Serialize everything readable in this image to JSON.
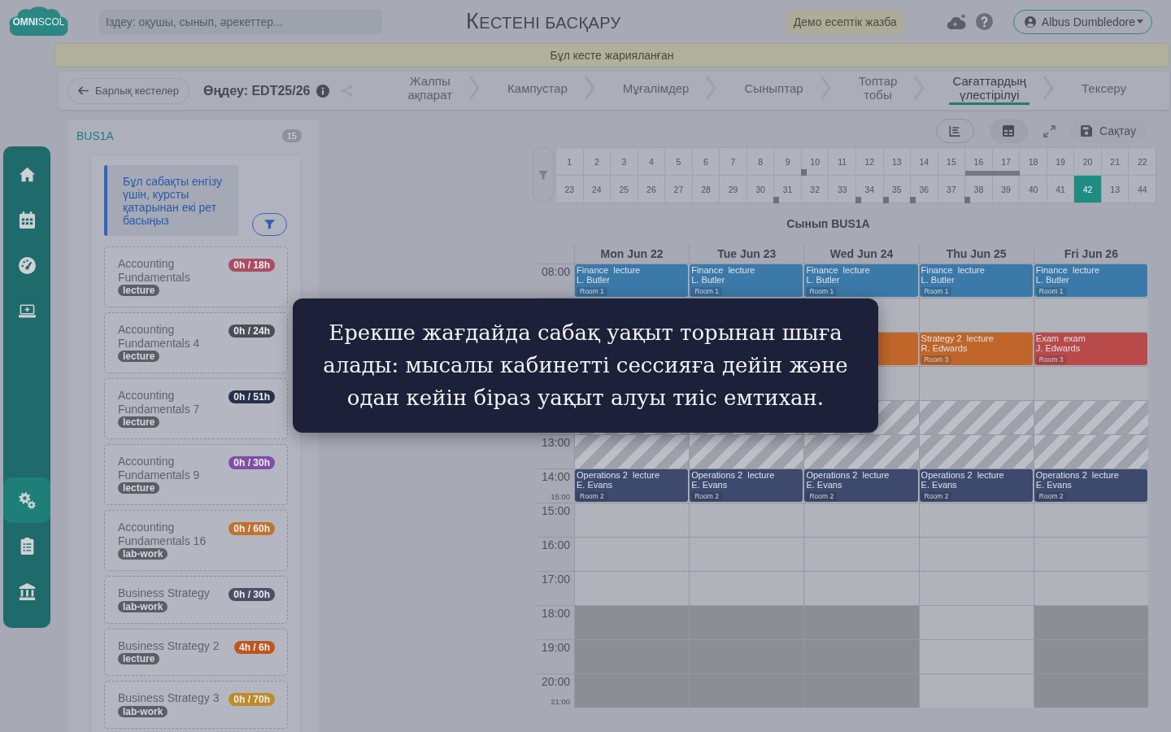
{
  "header": {
    "logo": "**OMNI**SCOL",
    "search": {
      "placeholder": "Іздеу: оқушы, сынып, әрекеттер..."
    },
    "title": "КЕСТЕНІ БАСҚАРУ",
    "demo_badge": "Демо есептік жазба",
    "user": {
      "name": "Albus Dumbledore"
    }
  },
  "banner": "Бұл кесте жарияланған",
  "sidebar": {
    "top_items": [
      {
        "kind": "home",
        "selected": false
      },
      {
        "kind": "calendar",
        "selected": false
      },
      {
        "kind": "gauge",
        "selected": false
      },
      {
        "kind": "laptop",
        "selected": false
      }
    ],
    "bottom_items": [
      {
        "kind": "gears",
        "selected": true
      },
      {
        "kind": "clipboard",
        "selected": false
      },
      {
        "kind": "bank",
        "selected": false
      }
    ]
  },
  "toolbar": {
    "back": "Барлық кестелер",
    "edit_title": "Өңдеу: EDT25/26",
    "steps": [
      {
        "label": "Жалпы ақпарат",
        "selected": false
      },
      {
        "label": "Кампустар",
        "selected": false
      },
      {
        "label": "Мұғалімдер",
        "selected": false
      },
      {
        "label": "Сыныптар",
        "selected": false
      },
      {
        "label": "Топтар тобы",
        "selected": false
      },
      {
        "label": "Сағаттардың үлестірілуі",
        "selected": true
      },
      {
        "label": "Тексеру",
        "selected": false
      }
    ]
  },
  "left_panel": {
    "title": "BUS1A",
    "count": "15",
    "hint": "Бұл сабақты енгізу үшін, курсты қатарынан екі рет басыңыз",
    "courses": [
      {
        "name": "Accounting Fundamentals",
        "hours": "0h / 18h",
        "color": "#a94d62",
        "type": "lecture"
      },
      {
        "name": "Accounting Fundamentals 4",
        "hours": "0h / 24h",
        "color": "#4b4e57",
        "type": "lecture"
      },
      {
        "name": "Accounting Fundamentals 7",
        "hours": "0h / 51h",
        "color": "#253148",
        "type": "lecture"
      },
      {
        "name": "Accounting Fundamentals 9",
        "hours": "0h / 30h",
        "color": "#7f4fa6",
        "type": "lecture"
      },
      {
        "name": "Accounting Fundamentals 16",
        "hours": "0h / 60h",
        "color": "#c0722f",
        "type": "lab-work"
      },
      {
        "name": "Business Strategy",
        "hours": "0h / 30h",
        "color": "#4a4f66",
        "type": "lab-work"
      },
      {
        "name": "Business Strategy 2",
        "hours": "4h / 6h",
        "color": "#be561e",
        "type": "lecture"
      },
      {
        "name": "Business Strategy 3",
        "hours": "0h / 70h",
        "color": "#bf8a2b",
        "type": "lab-work"
      }
    ]
  },
  "calendar": {
    "toolbar": {
      "views": [
        {
          "kind": "list",
          "selected": false
        },
        {
          "kind": "grid",
          "selected": true
        }
      ],
      "save": {
        "label": "Сақтау",
        "disabled": true
      }
    },
    "weeks": [
      {
        "label": "1",
        "selected": false
      },
      {
        "label": "2",
        "selected": false
      },
      {
        "label": "3",
        "selected": false
      },
      {
        "label": "4",
        "selected": false
      },
      {
        "label": "5",
        "selected": false
      },
      {
        "label": "6",
        "selected": false
      },
      {
        "label": "7",
        "selected": false
      },
      {
        "label": "8",
        "selected": false
      },
      {
        "label": "9",
        "selected": false
      },
      {
        "label": "10",
        "selected": false,
        "marker": {
          "kind": "dot"
        }
      },
      {
        "label": "11",
        "selected": false
      },
      {
        "label": "12",
        "selected": false
      },
      {
        "label": "13",
        "selected": false
      },
      {
        "label": "14",
        "selected": false
      },
      {
        "label": "15",
        "selected": false
      },
      {
        "label": "16",
        "selected": false,
        "marker": {
          "kind": "bar"
        }
      },
      {
        "label": "17",
        "selected": false,
        "marker": {
          "kind": "bar"
        }
      },
      {
        "label": "18",
        "selected": false
      },
      {
        "label": "19",
        "selected": false
      },
      {
        "label": "20",
        "selected": false
      },
      {
        "label": "21",
        "selected": false
      },
      {
        "label": "22",
        "selected": false
      },
      {
        "label": "23",
        "selected": false
      },
      {
        "label": "24",
        "selected": false
      },
      {
        "label": "25",
        "selected": false
      },
      {
        "label": "26",
        "selected": false
      },
      {
        "label": "27",
        "selected": false
      },
      {
        "label": "28",
        "selected": false
      },
      {
        "label": "29",
        "selected": false
      },
      {
        "label": "30",
        "selected": false
      },
      {
        "label": "31",
        "selected": false,
        "marker": {
          "kind": "dot"
        }
      },
      {
        "label": "32",
        "selected": false
      },
      {
        "label": "33",
        "selected": false
      },
      {
        "label": "34",
        "selected": false,
        "marker": {
          "kind": "dot"
        }
      },
      {
        "label": "35",
        "selected": false,
        "marker": {
          "kind": "dot"
        }
      },
      {
        "label": "36",
        "selected": false,
        "marker": {
          "kind": "dot"
        }
      },
      {
        "label": "37",
        "selected": false
      },
      {
        "label": "38",
        "selected": false,
        "marker": {
          "kind": "dot"
        }
      },
      {
        "label": "39",
        "selected": false
      },
      {
        "label": "40",
        "selected": false
      },
      {
        "label": "41",
        "selected": false
      },
      {
        "label": "42",
        "selected": true
      },
      {
        "label": "13",
        "selected": false
      },
      {
        "label": "44",
        "selected": false
      }
    ],
    "title": "Сынып BUS1A",
    "days": [
      {
        "label": "Mon Jun 22"
      },
      {
        "label": "Tue Jun 23"
      },
      {
        "label": "Wed Jun 24"
      },
      {
        "label": "Thu Jun 25"
      },
      {
        "label": "Fri Jun 26"
      }
    ],
    "rows": [
      {
        "kind": "hour",
        "label": "08:00",
        "cells": [
          {
            "kind": "event",
            "title": "Finance",
            "type": "lecture",
            "teacher": "L. Butler",
            "room": "Room 1",
            "color": "#3b79a9"
          },
          {
            "kind": "event",
            "title": "Finance",
            "type": "lecture",
            "teacher": "L. Butler",
            "room": "Room 1",
            "color": "#3b79a9"
          },
          {
            "kind": "event",
            "title": "Finance",
            "type": "lecture",
            "teacher": "L. Butler",
            "room": "Room 1",
            "color": "#3b79a9"
          },
          {
            "kind": "event",
            "title": "Finance",
            "type": "lecture",
            "teacher": "L. Butler",
            "room": "Room 1",
            "color": "#3b79a9"
          },
          {
            "kind": "event",
            "title": "Finance",
            "type": "lecture",
            "teacher": "L. Butler",
            "room": "Room 1",
            "color": "#3b79a9"
          }
        ]
      },
      {
        "kind": "hour",
        "cells": [
          {
            "kind": "covered"
          },
          {
            "kind": "covered"
          },
          {
            "kind": "free"
          },
          {
            "kind": "free"
          },
          {
            "kind": "free"
          }
        ]
      },
      {
        "kind": "hour",
        "cells": [
          {
            "kind": "covered"
          },
          {
            "kind": "covered"
          },
          {
            "kind": "event",
            "color": "#c0662a"
          },
          {
            "kind": "event",
            "title": "Strategy 2",
            "type": "lecture",
            "teacher": "R. Edwards",
            "room": "Room 3",
            "color": "#c0662a"
          },
          {
            "kind": "event",
            "title": "Exam",
            "type": "exam",
            "teacher": "J. Edwards",
            "room": "Room 3",
            "color": "#b84a4a"
          }
        ]
      },
      {
        "kind": "hour",
        "cells": [
          {
            "kind": "covered"
          },
          {
            "kind": "covered"
          },
          {
            "kind": "free"
          },
          {
            "kind": "free"
          },
          {
            "kind": "free"
          }
        ]
      },
      {
        "kind": "break",
        "cells": [
          {
            "kind": "covered"
          },
          {
            "kind": "covered"
          },
          {
            "kind": "free"
          },
          {
            "kind": "free"
          },
          {
            "kind": "free"
          }
        ]
      },
      {
        "kind": "break",
        "label": "13:00",
        "cells": [
          {
            "kind": "free"
          },
          {
            "kind": "free"
          },
          {
            "kind": "free"
          },
          {
            "kind": "free"
          },
          {
            "kind": "free"
          }
        ]
      },
      {
        "kind": "hour",
        "label": "14:00",
        "end_label": "15:00",
        "cells": [
          {
            "kind": "event",
            "title": "Operations 2",
            "type": "lecture",
            "teacher": "E. Evans",
            "room": "Room 2",
            "color": "#3d4a6e"
          },
          {
            "kind": "event",
            "title": "Operations 2",
            "type": "lecture",
            "teacher": "E. Evans",
            "room": "Room 2",
            "color": "#3d4a6e"
          },
          {
            "kind": "event",
            "title": "Operations 2",
            "type": "lecture",
            "teacher": "E. Evans",
            "room": "Room 2",
            "color": "#3d4a6e"
          },
          {
            "kind": "event",
            "title": "Operations 2",
            "type": "lecture",
            "teacher": "E. Evans",
            "room": "Room 2",
            "color": "#3d4a6e"
          },
          {
            "kind": "event",
            "title": "Operations 2",
            "type": "lecture",
            "teacher": "E. Evans",
            "room": "Room 2",
            "color": "#3d4a6e"
          }
        ]
      },
      {
        "kind": "hour",
        "label": "15:00",
        "cells": [
          {
            "kind": "free"
          },
          {
            "kind": "free"
          },
          {
            "kind": "free"
          },
          {
            "kind": "free"
          },
          {
            "kind": "free"
          }
        ]
      },
      {
        "kind": "hour",
        "label": "16:00",
        "cells": [
          {
            "kind": "free"
          },
          {
            "kind": "free"
          },
          {
            "kind": "free"
          },
          {
            "kind": "free"
          },
          {
            "kind": "free"
          }
        ]
      },
      {
        "kind": "hour",
        "label": "17:00",
        "cells": [
          {
            "kind": "free"
          },
          {
            "kind": "free"
          },
          {
            "kind": "free"
          },
          {
            "kind": "free"
          },
          {
            "kind": "free"
          }
        ]
      },
      {
        "kind": "hour",
        "label": "18:00",
        "cells": [
          {
            "kind": "unavailable"
          },
          {
            "kind": "unavailable"
          },
          {
            "kind": "unavailable"
          },
          {
            "kind": "free"
          },
          {
            "kind": "unavailable"
          }
        ]
      },
      {
        "kind": "hour",
        "label": "19:00",
        "cells": [
          {
            "kind": "unavailable"
          },
          {
            "kind": "unavailable"
          },
          {
            "kind": "unavailable"
          },
          {
            "kind": "free"
          },
          {
            "kind": "unavailable"
          }
        ]
      },
      {
        "kind": "hour",
        "label": "20:00",
        "end_label": "21:00",
        "cells": [
          {
            "kind": "unavailable"
          },
          {
            "kind": "unavailable"
          },
          {
            "kind": "unavailable"
          },
          {
            "kind": "free"
          },
          {
            "kind": "unavailable"
          }
        ]
      }
    ]
  },
  "tour_tooltip": {
    "text": "Ерекше жағдайда сабақ уақыт торынан шыға алады: мысалы кабинетті сессияға дейін және одан кейін біраз уақыт алуы тиіс емтихан."
  }
}
